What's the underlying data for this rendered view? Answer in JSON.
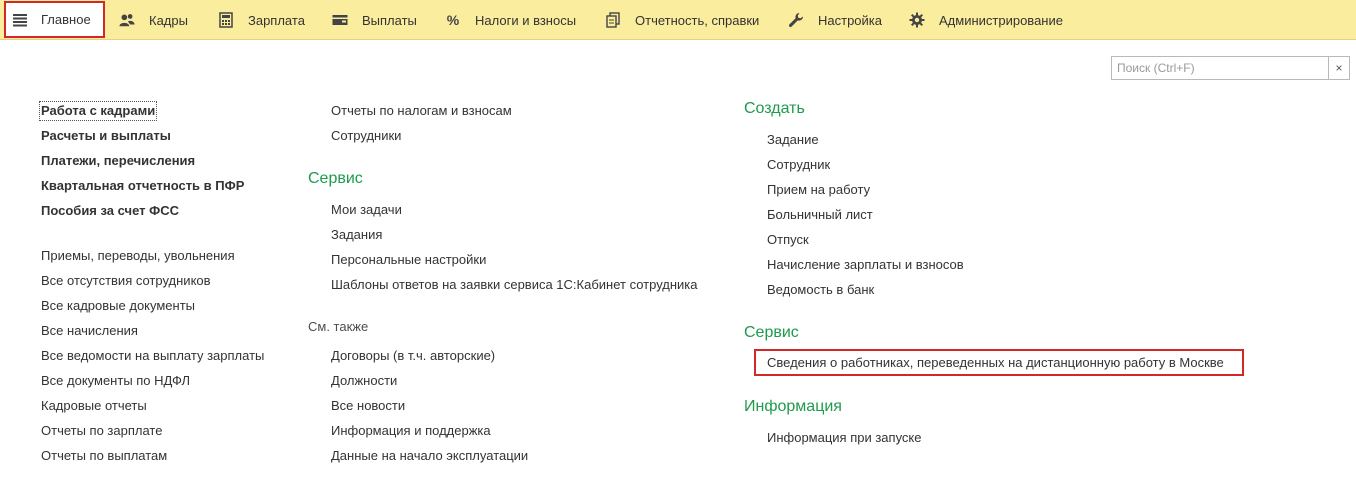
{
  "colors": {
    "topbar_bg": "#fbed9e",
    "highlight": "#d22828",
    "header_green": "#1e9b4b",
    "text": "#333333"
  },
  "topbar": {
    "items": [
      {
        "label": "Главное",
        "icon": "hamburger-menu-icon"
      },
      {
        "label": "Кадры",
        "icon": "people-icon"
      },
      {
        "label": "Зарплата",
        "icon": "calculator-icon"
      },
      {
        "label": "Выплаты",
        "icon": "wallet-icon"
      },
      {
        "label": "Налоги и взносы",
        "icon": "percent-icon"
      },
      {
        "label": "Отчетность, справки",
        "icon": "documents-icon"
      },
      {
        "label": "Настройка",
        "icon": "wrench-icon"
      },
      {
        "label": "Администрирование",
        "icon": "gear-icon"
      }
    ]
  },
  "search": {
    "placeholder": "Поиск (Ctrl+F)",
    "value": "",
    "clear_label": "×"
  },
  "col1": {
    "bold_links": [
      "Работа с кадрами",
      "Расчеты и выплаты",
      "Платежи, перечисления",
      "Квартальная отчетность в ПФР",
      "Пособия за счет ФСС"
    ],
    "links": [
      "Приемы, переводы, увольнения",
      "Все отсутствия сотрудников",
      "Все кадровые документы",
      "Все начисления",
      "Все ведомости на выплату зарплаты",
      "Все документы по НДФЛ",
      "Кадровые отчеты",
      "Отчеты по зарплате",
      "Отчеты по выплатам"
    ]
  },
  "col2": {
    "top_links": [
      "Отчеты по налогам и взносам",
      "Сотрудники"
    ],
    "service_header": "Сервис",
    "service_links": [
      "Мои задачи",
      "Задания",
      "Персональные настройки",
      "Шаблоны ответов на заявки сервиса 1С:Кабинет сотрудника"
    ],
    "see_also_header": "См. также",
    "see_also_links": [
      "Договоры (в т.ч. авторские)",
      "Должности",
      "Все новости",
      "Информация и поддержка",
      "Данные на начало эксплуатации"
    ]
  },
  "col3": {
    "create_header": "Создать",
    "create_links": [
      "Задание",
      "Сотрудник",
      "Прием на работу",
      "Больничный лист",
      "Отпуск",
      "Начисление зарплаты и взносов",
      "Ведомость в банк"
    ],
    "service_header": "Сервис",
    "service_links": [
      "Сведения о работниках, переведенных на дистанционную работу в Москве"
    ],
    "info_header": "Информация",
    "info_links": [
      "Информация при запуске"
    ]
  }
}
